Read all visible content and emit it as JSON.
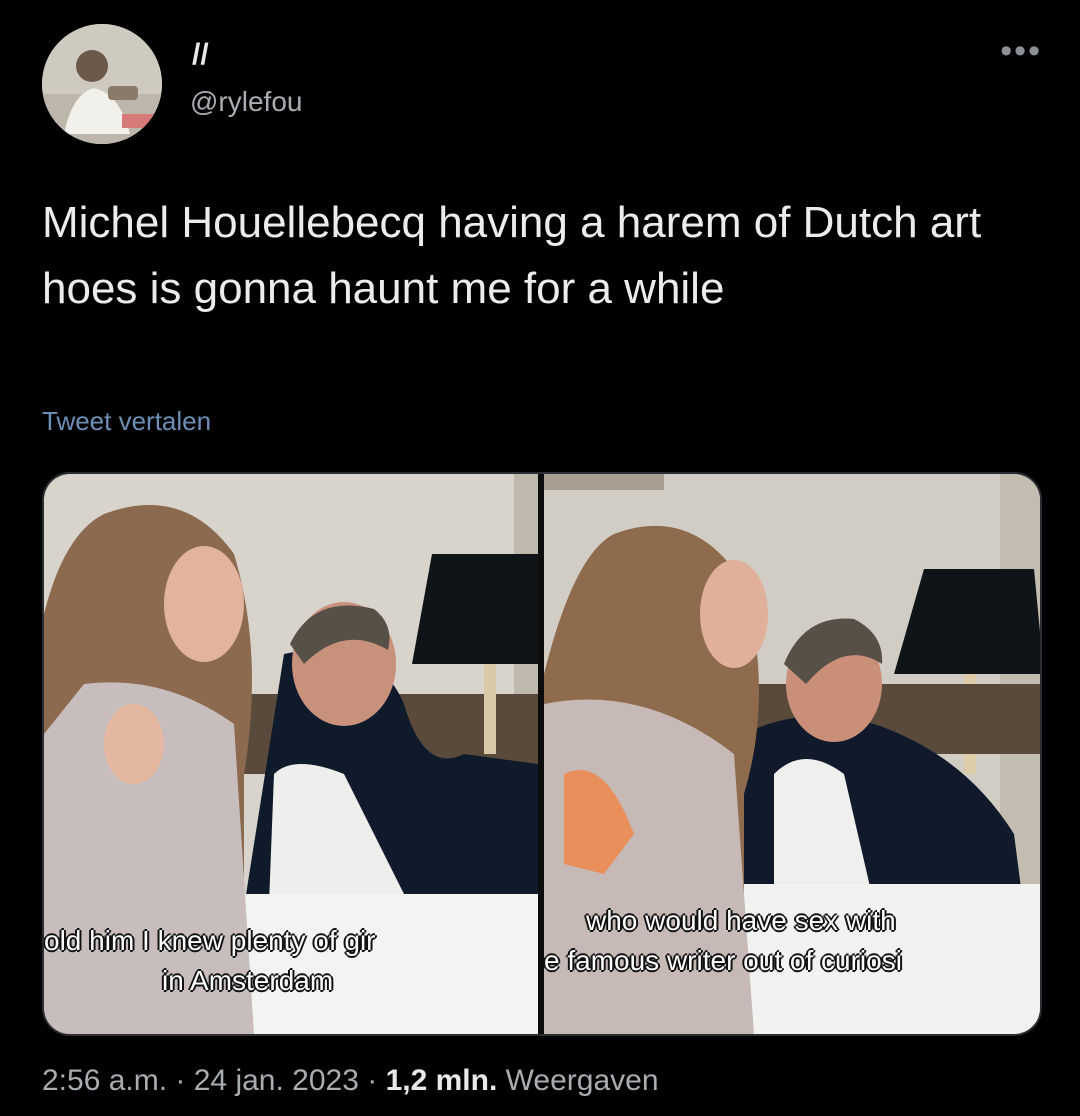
{
  "author": {
    "display_name": "//",
    "handle": "@rylefou"
  },
  "more_icon": "ellipsis-icon",
  "tweet": {
    "text": "Michel Houellebecq having a harem of Dutch art hoes is gonna haunt me for a while",
    "translate_label": "Tweet vertalen"
  },
  "media": {
    "left_subtitle_line1": "old him I knew plenty of gir",
    "left_subtitle_line2": "in Amsterdam",
    "right_subtitle_line1": "who would have sex with",
    "right_subtitle_line2": "e famous writer out of curiosi"
  },
  "meta": {
    "time": "2:56 a.m.",
    "sep1": " · ",
    "date": "24 jan. 2023",
    "sep2": " · ",
    "views_count": "1,2 mln.",
    "views_label": " Weergaven"
  }
}
